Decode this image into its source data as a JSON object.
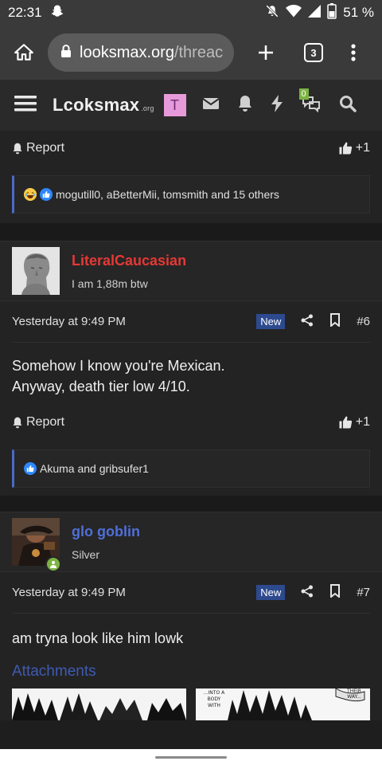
{
  "status": {
    "time": "22:31",
    "battery": "51 %"
  },
  "browser": {
    "url_host": "looksmax.org",
    "url_path": "/threac",
    "tab_count": "3"
  },
  "site": {
    "brand": "Lcoksmax",
    "brand_suffix": ".org",
    "user_initial": "T",
    "conversation_badge": "0"
  },
  "posts": [
    {
      "report_label": "Report",
      "plus_label": "+1",
      "reactions_text": "mogutill0, aBetterMii, tomsmith and 15 others"
    },
    {
      "username": "LiteralCaucasian",
      "user_title": "I am 1,88m btw",
      "timestamp": "Yesterday at 9:49 PM",
      "new_label": "New",
      "number": "#6",
      "text_line1": "Somehow I know you're Mexican.",
      "text_line2": "Anyway, death tier low 4/10.",
      "report_label": "Report",
      "plus_label": "+1",
      "reactions_text": "Akuma and gribsufer1"
    },
    {
      "username": "glo goblin",
      "user_title": "Silver",
      "timestamp": "Yesterday at 9:49 PM",
      "new_label": "New",
      "number": "#7",
      "text_line1": "am tryna look like him lowk",
      "attachments_label": "Attachments",
      "thumb2_text": "...INTO A BODY WITH",
      "thumb2_corner": "THEIR WAY..."
    }
  ],
  "colors": {
    "username_red": "#e53935",
    "username_blue": "#4f6fd8",
    "accent_blue": "#4a6bc4",
    "online_green": "#7cb342"
  }
}
